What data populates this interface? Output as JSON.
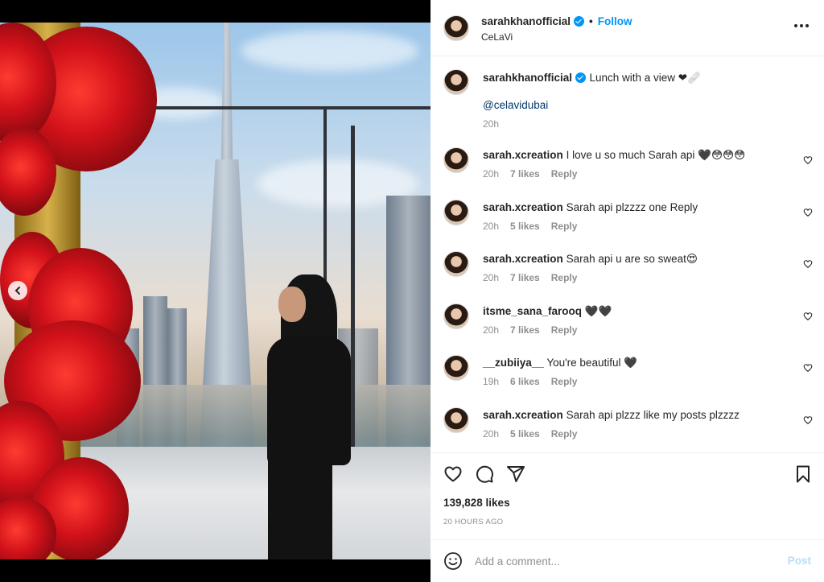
{
  "post": {
    "username": "sarahkhanofficial",
    "follow_label": "Follow",
    "separator": "•",
    "location": "CeLaVi",
    "more_label": "•••"
  },
  "caption": {
    "username": "sarahkhanofficial",
    "text": "Lunch with a view ❤︎‍🩹",
    "mention": "@celavidubai",
    "time": "20h"
  },
  "comments": [
    {
      "username": "sarah.xcreation",
      "text": "I love u so much Sarah api 🖤😳😳😳",
      "time": "20h",
      "likes": "7 likes",
      "reply": "Reply"
    },
    {
      "username": "sarah.xcreation",
      "text": "Sarah api plzzzz one Reply",
      "time": "20h",
      "likes": "5 likes",
      "reply": "Reply"
    },
    {
      "username": "sarah.xcreation",
      "text": "Sarah api u are so sweat😍",
      "time": "20h",
      "likes": "7 likes",
      "reply": "Reply"
    },
    {
      "username": "itsme_sana_farooq",
      "text": "🖤🖤",
      "time": "20h",
      "likes": "7 likes",
      "reply": "Reply"
    },
    {
      "username": "__zubiiya__",
      "text": "You're beautiful 🖤",
      "time": "19h",
      "likes": "6 likes",
      "reply": "Reply"
    },
    {
      "username": "sarah.xcreation",
      "text": "Sarah api plzzz like my posts plzzzz",
      "time": "20h",
      "likes": "5 likes",
      "reply": "Reply"
    }
  ],
  "stats": {
    "likes": "139,828 likes",
    "time_ago": "20 HOURS AGO"
  },
  "add_comment": {
    "placeholder": "Add a comment...",
    "post_label": "Post"
  },
  "icons": [
    "chevron-left-icon",
    "more-icon",
    "heart-icon",
    "comment-icon",
    "share-icon",
    "bookmark-icon",
    "emoji-icon",
    "verified-icon"
  ],
  "colors": {
    "accent": "#0095f6",
    "text": "#262626",
    "muted": "#8e8e8e",
    "post_disabled": "#b2dffc"
  },
  "carousel": {
    "slides": 2,
    "active": 2
  }
}
